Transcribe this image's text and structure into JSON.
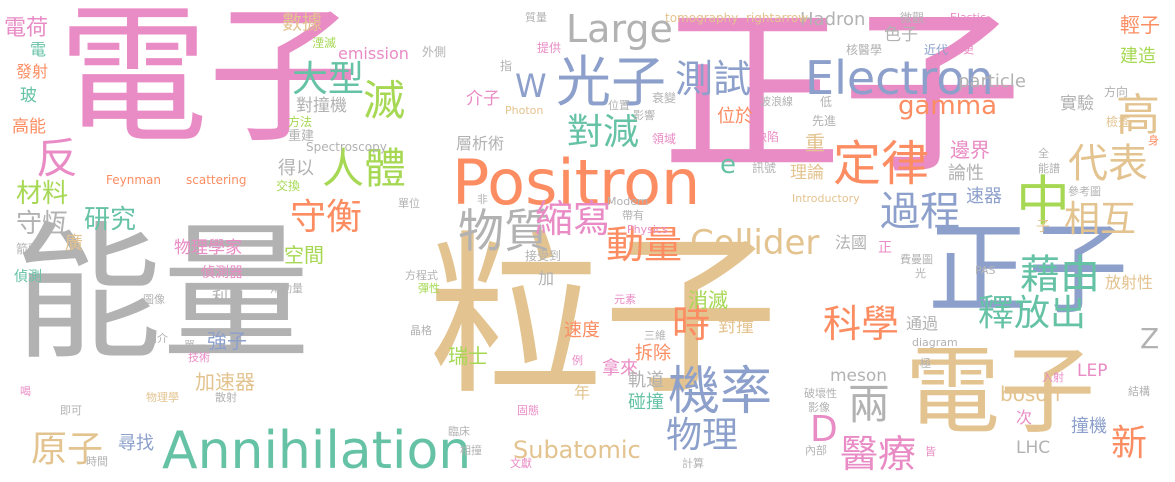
{
  "words": [
    {
      "text": "電子",
      "color": "#e98bc4"
    },
    {
      "text": "正子",
      "color": "#e98bc4"
    },
    {
      "text": "能量",
      "color": "#b2b2b2"
    },
    {
      "text": "粒子",
      "color": "#e3c38f"
    },
    {
      "text": "電子",
      "color": "#e3c38f"
    },
    {
      "text": "正子",
      "color": "#8da0cb"
    },
    {
      "text": "Positron",
      "color": "#fc8d62"
    },
    {
      "text": "Annihilation",
      "color": "#66c2a5"
    },
    {
      "text": "Electron",
      "color": "#8da0cb"
    },
    {
      "text": "光子",
      "color": "#8da0cb"
    },
    {
      "text": "機率",
      "color": "#8da0cb"
    },
    {
      "text": "物質",
      "color": "#b2b2b2"
    },
    {
      "text": "縮寫",
      "color": "#e98bc4"
    },
    {
      "text": "定律",
      "color": "#fc8d62"
    },
    {
      "text": "中",
      "color": "#a6d854"
    },
    {
      "text": "過程",
      "color": "#8da0cb"
    },
    {
      "text": "代表",
      "color": "#e3c38f"
    },
    {
      "text": "對減",
      "color": "#66c2a5"
    },
    {
      "text": "人體",
      "color": "#a6d854"
    },
    {
      "text": "守衡",
      "color": "#fc8d62"
    },
    {
      "text": "滅",
      "color": "#a6d854"
    },
    {
      "text": "大型",
      "color": "#66c2a5"
    },
    {
      "text": "反",
      "color": "#e98bc4"
    },
    {
      "text": "高",
      "color": "#e3c38f"
    },
    {
      "text": "Collider",
      "color": "#e3c38f"
    },
    {
      "text": "Large",
      "color": "#b2b2b2"
    },
    {
      "text": "測試",
      "color": "#8da0cb"
    },
    {
      "text": "動量",
      "color": "#fc8d62"
    },
    {
      "text": "時",
      "color": "#fc8d62"
    },
    {
      "text": "科學",
      "color": "#fc8d62"
    },
    {
      "text": "藉由",
      "color": "#66c2a5"
    },
    {
      "text": "釋放出",
      "color": "#66c2a5"
    },
    {
      "text": "相互",
      "color": "#e3c38f"
    },
    {
      "text": "醫療",
      "color": "#e98bc4"
    },
    {
      "text": "兩",
      "color": "#b2b2b2"
    },
    {
      "text": "物理",
      "color": "#8da0cb"
    },
    {
      "text": "D",
      "color": "#e98bc4"
    },
    {
      "text": "原子",
      "color": "#e3c38f"
    },
    {
      "text": "新",
      "color": "#fc8d62"
    },
    {
      "text": "研究",
      "color": "#66c2a5"
    },
    {
      "text": "材料",
      "color": "#a6d854"
    },
    {
      "text": "守恆",
      "color": "#b2b2b2"
    },
    {
      "text": "gamma",
      "color": "#fc8d62"
    },
    {
      "text": "W",
      "color": "#8da0cb"
    },
    {
      "text": "e",
      "color": "#66c2a5"
    },
    {
      "text": "Z",
      "color": "#b2b2b2"
    },
    {
      "text": "Subatomic",
      "color": "#e3c38f"
    },
    {
      "text": "數據",
      "color": "#e3c38f"
    },
    {
      "text": "Hadron",
      "color": "#b2b2b2"
    },
    {
      "text": "電荷",
      "color": "#e98bc4"
    },
    {
      "text": "輕子",
      "color": "#fc8d62"
    },
    {
      "text": "建造",
      "color": "#a6d854"
    },
    {
      "text": "色子",
      "color": "#b2b2b2"
    },
    {
      "text": "實驗",
      "color": "#b2b2b2"
    },
    {
      "text": "重",
      "color": "#e3c38f"
    },
    {
      "text": "邊界",
      "color": "#e98bc4"
    },
    {
      "text": "論性",
      "color": "#b2b2b2"
    },
    {
      "text": "速器",
      "color": "#8da0cb"
    },
    {
      "text": "理論",
      "color": "#e3c38f"
    },
    {
      "text": "物理學家",
      "color": "#e98bc4"
    },
    {
      "text": "空間",
      "color": "#a6d854"
    },
    {
      "text": "消滅",
      "color": "#a6d854"
    },
    {
      "text": "對撞",
      "color": "#e3c38f"
    },
    {
      "text": "速度",
      "color": "#fc8d62"
    },
    {
      "text": "拆除",
      "color": "#fc8d62"
    },
    {
      "text": "瑞士",
      "color": "#a6d854"
    },
    {
      "text": "拿來",
      "color": "#e98bc4"
    },
    {
      "text": "軌道",
      "color": "#b2b2b2"
    },
    {
      "text": "碰撞",
      "color": "#66c2a5"
    },
    {
      "text": "年",
      "color": "#e3c38f"
    },
    {
      "text": "強子",
      "color": "#8da0cb"
    },
    {
      "text": "加速器",
      "color": "#e3c38f"
    },
    {
      "text": "尋找",
      "color": "#8da0cb"
    },
    {
      "text": "meson",
      "color": "#b2b2b2"
    },
    {
      "text": "boson",
      "color": "#e3c38f"
    },
    {
      "text": "LHC",
      "color": "#b2b2b2"
    },
    {
      "text": "LEP",
      "color": "#e98bc4"
    },
    {
      "text": "撞機",
      "color": "#8da0cb"
    },
    {
      "text": "particle",
      "color": "#b2b2b2"
    },
    {
      "text": "emission",
      "color": "#e98bc4"
    },
    {
      "text": "對撞機",
      "color": "#b2b2b2"
    },
    {
      "text": "介子",
      "color": "#e98bc4"
    },
    {
      "text": "位於",
      "color": "#fc8d62"
    },
    {
      "text": "得以",
      "color": "#b2b2b2"
    },
    {
      "text": "層析術",
      "color": "#b2b2b2"
    },
    {
      "text": "利用",
      "color": "#b2b2b2"
    },
    {
      "text": "法國",
      "color": "#b2b2b2"
    },
    {
      "text": "通過",
      "color": "#b2b2b2"
    },
    {
      "text": "放射性",
      "color": "#e3c38f"
    },
    {
      "text": "次",
      "color": "#e98bc4"
    },
    {
      "text": "正",
      "color": "#e98bc4"
    },
    {
      "text": "子",
      "color": "#e3c38f"
    },
    {
      "text": "偵測器",
      "color": "#e98bc4"
    },
    {
      "text": "廣",
      "color": "#e3c38f"
    },
    {
      "text": "加",
      "color": "#b2b2b2"
    },
    {
      "text": "玻",
      "color": "#66c2a5"
    },
    {
      "text": "高能",
      "color": "#fc8d62"
    },
    {
      "text": "電",
      "color": "#66c2a5"
    },
    {
      "text": "發射",
      "color": "#fc8d62"
    },
    {
      "text": "偵測",
      "color": "#66c2a5"
    },
    {
      "text": "箭頭",
      "color": "#b2b2b2"
    },
    {
      "text": "重建",
      "color": "#b2b2b2"
    },
    {
      "text": "方法",
      "color": "#a6d854"
    },
    {
      "text": "Spectroscopy",
      "color": "#b2b2b2"
    },
    {
      "text": "交換",
      "color": "#a6d854"
    },
    {
      "text": "Feynman",
      "color": "#fc8d62"
    },
    {
      "text": "scattering",
      "color": "#fc8d62"
    },
    {
      "text": "tomography",
      "color": "#e3c38f"
    },
    {
      "text": "rightarrow",
      "color": "#e3c38f"
    },
    {
      "text": "微觀",
      "color": "#b2b2b2"
    },
    {
      "text": "Elastic",
      "color": "#e98bc4"
    },
    {
      "text": "質量",
      "color": "#b2b2b2"
    },
    {
      "text": "湮滅",
      "color": "#a6d854"
    },
    {
      "text": "外側",
      "color": "#b2b2b2"
    },
    {
      "text": "提供",
      "color": "#e98bc4"
    },
    {
      "text": "核醫學",
      "color": "#b2b2b2"
    },
    {
      "text": "近代",
      "color": "#8da0cb"
    },
    {
      "text": "更",
      "color": "#e98bc4"
    },
    {
      "text": "指",
      "color": "#b2b2b2"
    },
    {
      "text": "衰變",
      "color": "#b2b2b2"
    },
    {
      "text": "波浪線",
      "color": "#b2b2b2"
    },
    {
      "text": "低",
      "color": "#b2b2b2"
    },
    {
      "text": "方向",
      "color": "#b2b2b2"
    },
    {
      "text": "Photon",
      "color": "#e3c38f"
    },
    {
      "text": "影響",
      "color": "#b2b2b2"
    },
    {
      "text": "先進",
      "color": "#b2b2b2"
    },
    {
      "text": "檢查",
      "color": "#e3c38f"
    },
    {
      "text": "領域",
      "color": "#e98bc4"
    },
    {
      "text": "缺陷",
      "color": "#e98bc4"
    },
    {
      "text": "身",
      "color": "#fc8d62"
    },
    {
      "text": "全",
      "color": "#b2b2b2"
    },
    {
      "text": "能譜",
      "color": "#b2b2b2"
    },
    {
      "text": "訊號",
      "color": "#b2b2b2"
    },
    {
      "text": "Introductory",
      "color": "#e3c38f"
    },
    {
      "text": "參考圖",
      "color": "#b2b2b2"
    },
    {
      "text": "非",
      "color": "#b2b2b2"
    },
    {
      "text": "Modern",
      "color": "#b2b2b2"
    },
    {
      "text": "單位",
      "color": "#b2b2b2"
    },
    {
      "text": "帶有",
      "color": "#b2b2b2"
    },
    {
      "text": "Physics",
      "color": "#e98bc4"
    },
    {
      "text": "接受到",
      "color": "#b2b2b2"
    },
    {
      "text": "費曼圖",
      "color": "#b2b2b2"
    },
    {
      "text": "PAS",
      "color": "#b2b2b2"
    },
    {
      "text": "光",
      "color": "#b2b2b2"
    },
    {
      "text": "方程式",
      "color": "#b2b2b2"
    },
    {
      "text": "彈性",
      "color": "#a6d854"
    },
    {
      "text": "角動量",
      "color": "#b2b2b2"
    },
    {
      "text": "元素",
      "color": "#e98bc4"
    },
    {
      "text": "圖像",
      "color": "#b2b2b2"
    },
    {
      "text": "晶格",
      "color": "#b2b2b2"
    },
    {
      "text": "簡介",
      "color": "#b2b2b2"
    },
    {
      "text": "單一",
      "color": "#b2b2b2"
    },
    {
      "text": "技術",
      "color": "#e98bc4"
    },
    {
      "text": "三維",
      "color": "#b2b2b2"
    },
    {
      "text": "例",
      "color": "#e98bc4"
    },
    {
      "text": "diagram",
      "color": "#b2b2b2"
    },
    {
      "text": "極",
      "color": "#b2b2b2"
    },
    {
      "text": "入射",
      "color": "#e98bc4"
    },
    {
      "text": "喝",
      "color": "#e98bc4"
    },
    {
      "text": "物理學",
      "color": "#e3c38f"
    },
    {
      "text": "散射",
      "color": "#b2b2b2"
    },
    {
      "text": "即可",
      "color": "#b2b2b2"
    },
    {
      "text": "固態",
      "color": "#e98bc4"
    },
    {
      "text": "破壞性",
      "color": "#b2b2b2"
    },
    {
      "text": "影像",
      "color": "#b2b2b2"
    },
    {
      "text": "結構",
      "color": "#b2b2b2"
    },
    {
      "text": "臨床",
      "color": "#b2b2b2"
    },
    {
      "text": "相撞",
      "color": "#b2b2b2"
    },
    {
      "text": "文獻",
      "color": "#e98bc4"
    },
    {
      "text": "計算",
      "color": "#b2b2b2"
    },
    {
      "text": "內部",
      "color": "#b2b2b2"
    },
    {
      "text": "皆",
      "color": "#e98bc4"
    },
    {
      "text": "時間",
      "color": "#b2b2b2"
    },
    {
      "text": "位置",
      "color": "#b2b2b2"
    }
  ]
}
